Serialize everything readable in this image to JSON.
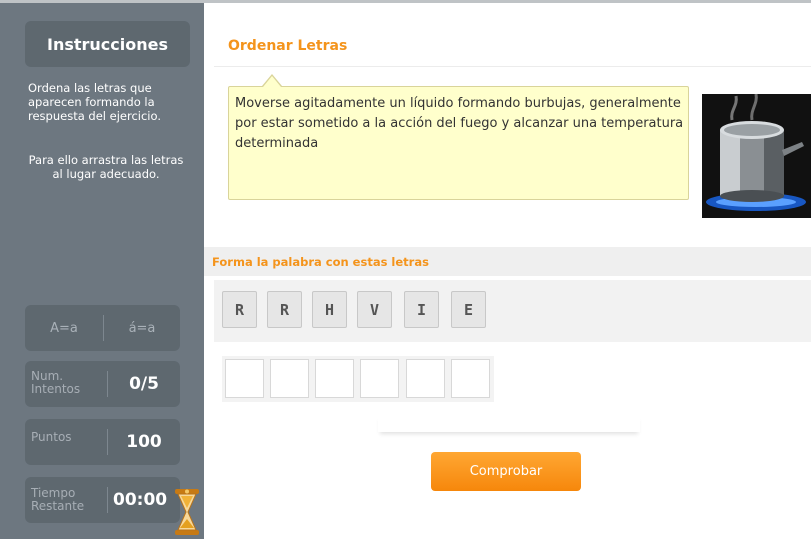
{
  "sidebar": {
    "header": "Instrucciones",
    "instructions_1": "Ordena las letras que aparecen formando la respuesta del ejercicio.",
    "instructions_2": "Para ello arrastra las letras al lugar adecuado.",
    "case_option_a": "A=a",
    "case_option_b": "á=a",
    "attempts_label_1": "Num.",
    "attempts_label_2": "Intentos",
    "attempts_value": "0/5",
    "points_label": "Puntos",
    "points_value": "100",
    "time_label_1": "Tiempo",
    "time_label_2": "Restante",
    "time_value": "00:00"
  },
  "main": {
    "title": "Ordenar Letras",
    "clue": "Moverse agitadamente un líquido formando burbujas, generalmente por estar sometido a la acción del fuego y alcanzar una temperatura determinada",
    "letters_heading": "Forma la palabra con estas letras",
    "letters": [
      "R",
      "R",
      "H",
      "V",
      "I",
      "E"
    ],
    "answer_slots": [
      "",
      "",
      "",
      "",
      "",
      ""
    ],
    "check_button": "Comprobar"
  },
  "colors": {
    "accent": "#f4941c",
    "sidebar": "#6d7780",
    "bubble": "#ffffcc"
  },
  "icons": {
    "hourglass": "hourglass-icon"
  }
}
